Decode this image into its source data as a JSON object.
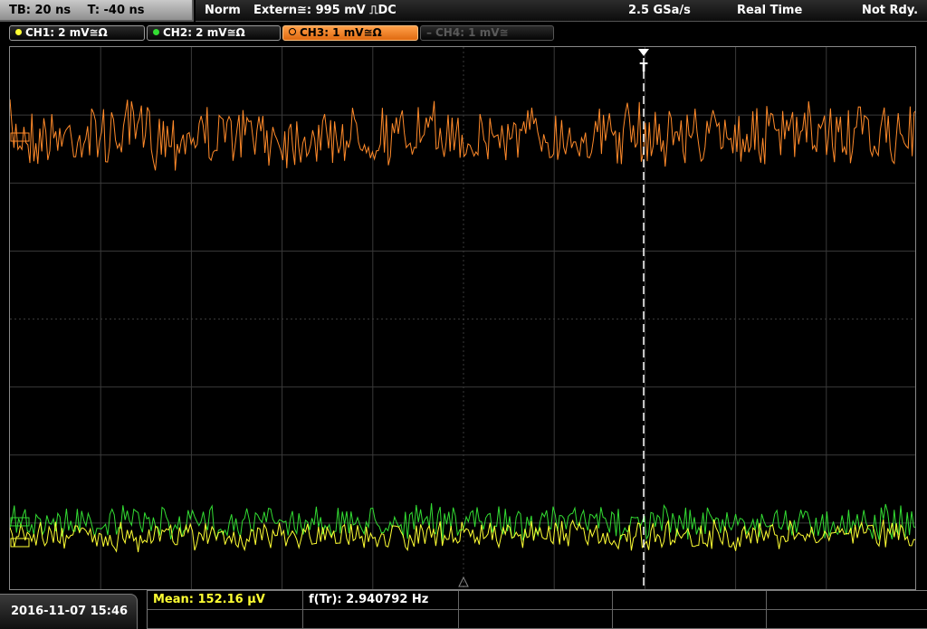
{
  "status": {
    "timebase": "TB: 20 ns",
    "trigger_time": "T: -40 ns",
    "mode": "Norm",
    "trigger": "Extern≅: 995 mV ⎍DC",
    "sample_rate": "2.5 GSa/s",
    "acq_mode": "Real Time",
    "state": "Not Rdy."
  },
  "channels": [
    {
      "label": "CH1: 2 mV≅Ω",
      "color": "#ffff33",
      "active": true
    },
    {
      "label": "CH2: 2 mV≅Ω",
      "color": "#33dd33",
      "active": true
    },
    {
      "label": "CH3: 1 mV≅Ω",
      "color": "#ff8a2a",
      "active": true,
      "selected": true
    },
    {
      "label": "CH4: 1 mV≅",
      "color": "#5a5a5a",
      "active": false
    }
  ],
  "trigger_marker": {
    "label": "T"
  },
  "footer": {
    "datetime": "2016-11-07 15:46",
    "measurements": [
      {
        "label": "Mean: 152.16 µV",
        "color": "#ffff33"
      },
      {
        "label": "f(Tr): 2.940792 Hz",
        "color": "#ffffff"
      }
    ]
  },
  "colors": {
    "ch1": "#ffff33",
    "ch2": "#33dd33",
    "ch3": "#ff8a2a",
    "grid": "#3a3a3a"
  }
}
